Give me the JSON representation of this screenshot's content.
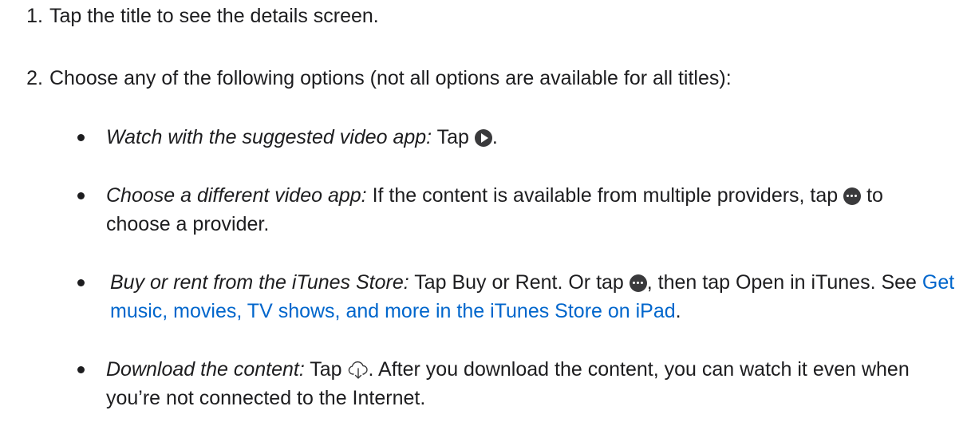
{
  "steps": [
    {
      "number": "1.",
      "text": "Tap the title to see the details screen."
    },
    {
      "number": "2.",
      "text": "Choose any of the following options (not all options are available for all titles):"
    }
  ],
  "bullets": [
    {
      "label": "Watch with the suggested video app:",
      "text_before_icon": " Tap ",
      "icon": "play-circle-icon",
      "text_after_icon": "."
    },
    {
      "label": "Choose a different video app:",
      "text_before_icon": " If the content is available from multiple providers, tap ",
      "icon": "more-circle-icon",
      "text_after_icon": " to choose a provider."
    },
    {
      "label": "Buy or rent from the iTunes Store:",
      "text_before_icon": " Tap Buy or Rent. Or tap ",
      "icon": "more-circle-icon",
      "text_after_icon": ", then tap Open in iTunes. See ",
      "link_text": "Get music, movies, TV shows, and more in the iTunes Store on iPad",
      "text_end": "."
    },
    {
      "label": "Download the content:",
      "text_before_icon": " Tap ",
      "icon": "cloud-download-icon",
      "text_after_icon": ". After you download the content, you can watch it even when you’re not connected to the Internet."
    }
  ],
  "colors": {
    "text": "#1d1d1f",
    "link": "#0066cc",
    "icon": "#3a3a3c"
  }
}
